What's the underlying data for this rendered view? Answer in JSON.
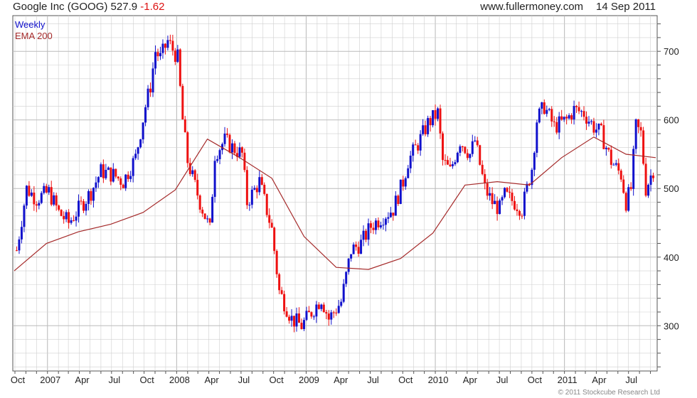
{
  "header": {
    "ticker_text": "Google Inc (GOOG) 527.9 ",
    "change": "-1.62",
    "site": "www.fullermoney.com",
    "date": "14 Sep 2011"
  },
  "legend": {
    "weekly": "Weekly",
    "ema": "EMA 200"
  },
  "copyright": "© 2011 Stockcube Research Ltd",
  "colors": {
    "up": "#1111cc",
    "down": "#ee1111",
    "ema": "#a52a2a",
    "grid": "#cfcfcf"
  },
  "chart_data": {
    "type": "candlestick-bar",
    "ylim": [
      234,
      752
    ],
    "y_ticks": [
      300,
      400,
      500,
      600,
      700
    ],
    "x_labels": [
      "Oct",
      "2007",
      "Apr",
      "Jul",
      "Oct",
      "2008",
      "Apr",
      "Jul",
      "Oct",
      "2009",
      "Apr",
      "Jul",
      "Oct",
      "2010",
      "Apr",
      "Jul",
      "Oct",
      "2011",
      "Apr",
      "Jul"
    ],
    "series": [
      {
        "name": "Weekly",
        "x": [
          "2006-10-06",
          "2006-11-03",
          "2006-12-01",
          "2007-01-05",
          "2007-02-02",
          "2007-03-02",
          "2007-04-06",
          "2007-05-04",
          "2007-06-01",
          "2007-07-06",
          "2007-08-03",
          "2007-09-07",
          "2007-10-05",
          "2007-10-19",
          "2007-11-02",
          "2007-11-16",
          "2007-12-07",
          "2008-01-04",
          "2008-01-18",
          "2008-02-01",
          "2008-03-07",
          "2008-04-04",
          "2008-04-18",
          "2008-05-16",
          "2008-06-06",
          "2008-07-04",
          "2008-07-18",
          "2008-08-22",
          "2008-09-26",
          "2008-10-17",
          "2008-11-21",
          "2008-12-19",
          "2009-01-16",
          "2009-02-13",
          "2009-03-06",
          "2009-04-10",
          "2009-05-08",
          "2009-06-05",
          "2009-07-03",
          "2009-08-07",
          "2009-09-04",
          "2009-10-02",
          "2009-10-16",
          "2009-11-13",
          "2009-12-11",
          "2010-01-08",
          "2010-01-22",
          "2010-02-12",
          "2010-03-12",
          "2010-04-09",
          "2010-04-23",
          "2010-05-21",
          "2010-06-11",
          "2010-07-02",
          "2010-07-16",
          "2010-08-13",
          "2010-09-03",
          "2010-10-01",
          "2010-10-15",
          "2010-11-05",
          "2010-12-03",
          "2011-01-07",
          "2011-01-28",
          "2011-02-25",
          "2011-03-25",
          "2011-04-15",
          "2011-05-13",
          "2011-06-10",
          "2011-06-24",
          "2011-07-08",
          "2011-07-22",
          "2011-08-05",
          "2011-08-19",
          "2011-09-09"
        ],
        "close": [
          410,
          500,
          485,
          495,
          465,
          450,
          475,
          495,
          525,
          520,
          510,
          545,
          620,
          650,
          700,
          690,
          715,
          690,
          600,
          540,
          480,
          440,
          550,
          570,
          560,
          550,
          480,
          510,
          440,
          350,
          310,
          300,
          320,
          340,
          310,
          335,
          410,
          420,
          445,
          460,
          470,
          510,
          540,
          565,
          595,
          610,
          540,
          525,
          570,
          550,
          570,
          500,
          480,
          470,
          490,
          480,
          470,
          530,
          600,
          620,
          590,
          600,
          615,
          610,
          590,
          580,
          540,
          520,
          480,
          500,
          590,
          580,
          500,
          527.9
        ]
      },
      {
        "name": "EMA 200",
        "x": [
          "2006-09-29",
          "2006-12-29",
          "2007-03-30",
          "2007-06-29",
          "2007-09-28",
          "2007-12-28",
          "2008-03-28",
          "2008-06-27",
          "2008-09-26",
          "2008-12-26",
          "2009-03-27",
          "2009-06-26",
          "2009-09-25",
          "2009-12-25",
          "2010-03-26",
          "2010-06-25",
          "2010-09-24",
          "2010-12-24",
          "2011-03-25",
          "2011-06-24",
          "2011-09-16"
        ],
        "values": [
          380,
          420,
          437,
          448,
          465,
          498,
          572,
          545,
          515,
          430,
          385,
          382,
          398,
          435,
          505,
          510,
          505,
          545,
          575,
          550,
          545
        ]
      }
    ]
  }
}
